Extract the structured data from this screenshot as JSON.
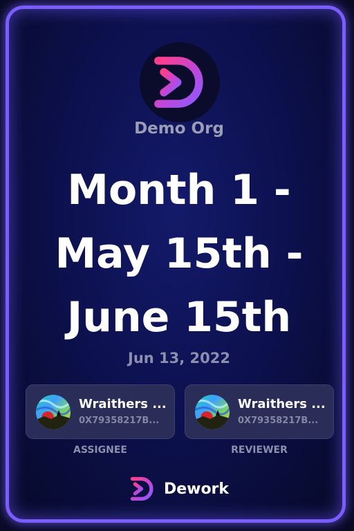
{
  "org": {
    "name": "Demo Org",
    "logo_icon": "dework-logo-icon"
  },
  "task": {
    "title": "Month 1 - May 15th - June 15th",
    "date": "Jun 13, 2022"
  },
  "people": {
    "assignee": {
      "name": "Wraithers ...",
      "address": "0X79358217B...",
      "role": "ASSIGNEE",
      "avatar_icon": "aurora-avatar"
    },
    "reviewer": {
      "name": "Wraithers ...",
      "address": "0X79358217B...",
      "role": "REVIEWER",
      "avatar_icon": "aurora-avatar"
    }
  },
  "footer": {
    "brand": "Dework",
    "brand_icon": "dework-logo-icon"
  },
  "colors": {
    "border": "#7a5cff",
    "background": "#0d1150",
    "logo_gradient_start": "#ff3e8a",
    "logo_gradient_end": "#8b5cff",
    "card_bg": "#2a2d58"
  }
}
